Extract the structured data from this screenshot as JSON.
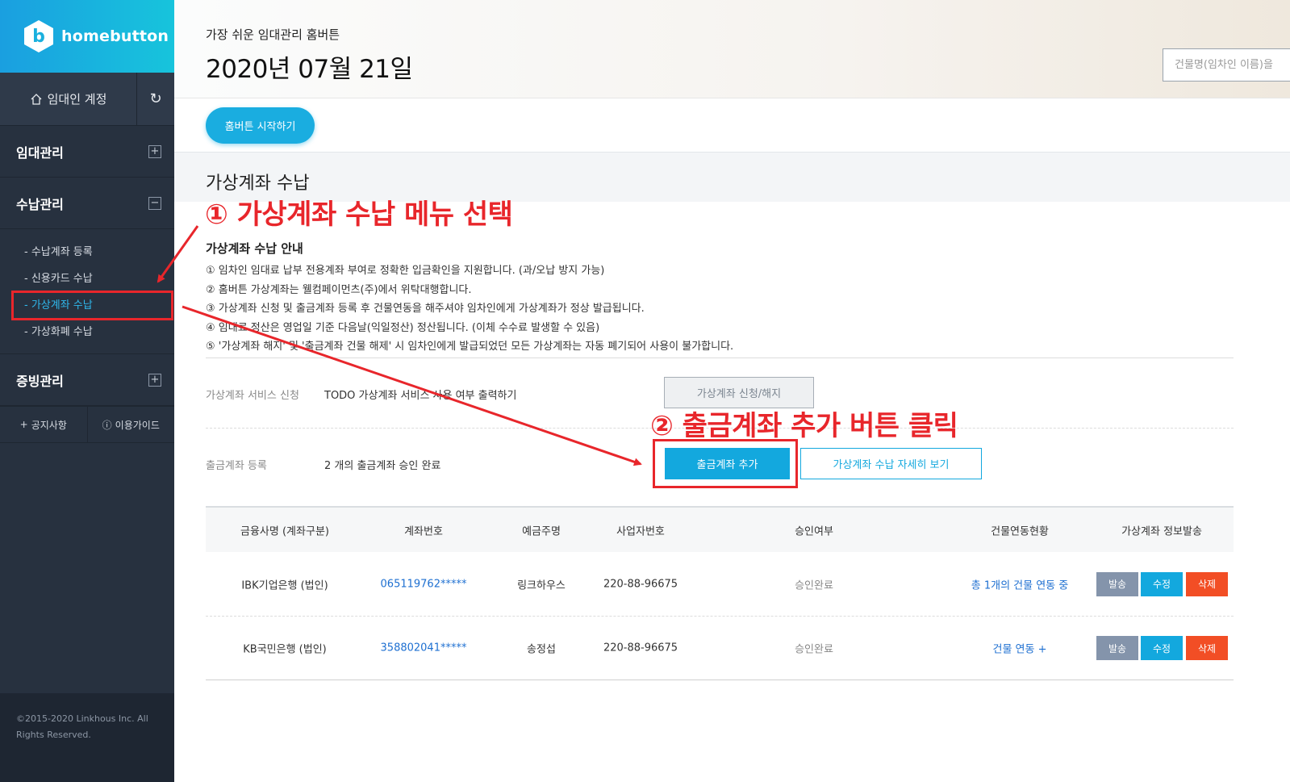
{
  "brand": {
    "name": "homebutton",
    "logo_letter": "b"
  },
  "sidebar": {
    "account_label": "임대인 계정",
    "refresh_icon": "↻",
    "groups": [
      {
        "label": "임대관리",
        "toggle": "+"
      },
      {
        "label": "수납관리",
        "toggle": "−"
      },
      {
        "label": "증빙관리",
        "toggle": "+"
      }
    ],
    "submenu": [
      "- 수납계좌 등록",
      "- 신용카드 수납",
      "- 가상계좌 수납",
      "- 가상화폐 수납"
    ],
    "bottom_links": [
      {
        "icon": "+",
        "label": "공지사항"
      },
      {
        "icon": "ⓘ",
        "label": "이용가이드"
      }
    ],
    "copyright": "©2015-2020 Linkhous Inc. All Rights Reserved."
  },
  "header": {
    "tagline": "가장 쉬운 임대관리 홈버튼",
    "date": "2020년 07월 21일",
    "search_placeholder": "건물명(임차인 이름)을"
  },
  "start_button": "홈버튼 시작하기",
  "section": {
    "title": "가상계좌 수납",
    "guide_title": "가상계좌 수납 안내",
    "guide_lines": [
      "① 임차인 임대료 납부 전용계좌 부여로 정확한 입금확인을 지원합니다. (과/오납 방지 가능)",
      "② 홈버튼 가상계좌는 웰컴페이먼츠(주)에서 위탁대행합니다.",
      "③ 가상계좌 신청 및 출금계좌 등록 후 건물연동을 해주셔야 임차인에게 가상계좌가 정상 발급됩니다.",
      "④ 임대료 정산은 영업일 기준 다음날(익일정산) 정산됩니다. (이체 수수료 발생할 수 있음)",
      "⑤ '가상계좌 해지' 및 '출금계좌 건물 해제' 시 임차인에게 발급되었던 모든 가상계좌는 자동 폐기되어 사용이 불가합니다."
    ]
  },
  "service": {
    "label": "가상계좌 서비스 신청",
    "value": "TODO 가상계좌 서비스 사용 여부 출력하기",
    "button": "가상계좌 신청/해지"
  },
  "withdraw": {
    "label": "출금계좌 등록",
    "value": "2 개의 출금계좌 승인 완료",
    "add_button": "출금계좌 추가",
    "detail_button": "가상계좌 수납 자세히 보기"
  },
  "table": {
    "headers": [
      "금융사명 (계좌구분)",
      "계좌번호",
      "예금주명",
      "사업자번호",
      "승인여부",
      "건물연동현황",
      "가상계좌 정보발송"
    ],
    "rows": [
      {
        "bank": "IBK기업은행 (법인)",
        "account": "065119762*****",
        "holder": "링크하우스",
        "biz": "220-88-96675",
        "status": "승인완료",
        "link": "총 1개의 건물 연동 중"
      },
      {
        "bank": "KB국민은행 (법인)",
        "account": "358802041*****",
        "holder": "송정섭",
        "biz": "220-88-96675",
        "status": "승인완료",
        "link": "건물 연동 +"
      }
    ],
    "actions": {
      "send": "발송",
      "edit": "수정",
      "delete": "삭제"
    }
  },
  "annotations": {
    "step1": "① 가상계좌 수납 메뉴 선택",
    "step2": "② 출금계좌 추가 버튼 클릭",
    "color": "#e8262b"
  }
}
